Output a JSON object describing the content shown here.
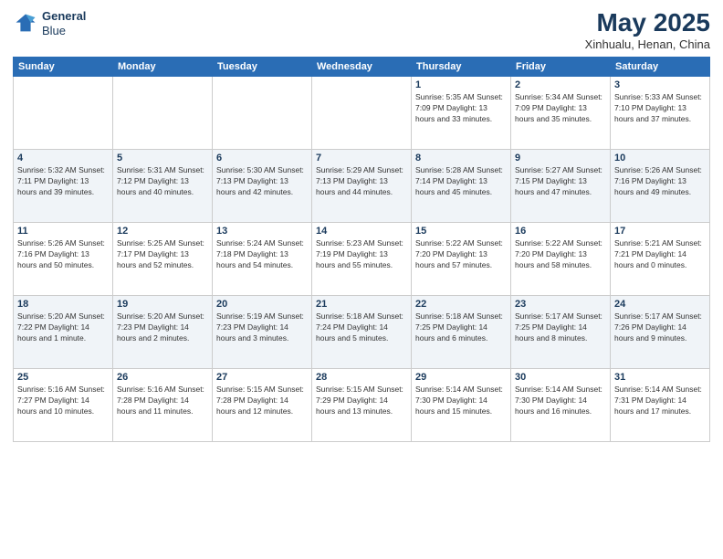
{
  "header": {
    "logo_line1": "General",
    "logo_line2": "Blue",
    "month": "May 2025",
    "location": "Xinhualu, Henan, China"
  },
  "weekdays": [
    "Sunday",
    "Monday",
    "Tuesday",
    "Wednesday",
    "Thursday",
    "Friday",
    "Saturday"
  ],
  "weeks": [
    [
      {
        "day": "",
        "info": ""
      },
      {
        "day": "",
        "info": ""
      },
      {
        "day": "",
        "info": ""
      },
      {
        "day": "",
        "info": ""
      },
      {
        "day": "1",
        "info": "Sunrise: 5:35 AM\nSunset: 7:09 PM\nDaylight: 13 hours\nand 33 minutes."
      },
      {
        "day": "2",
        "info": "Sunrise: 5:34 AM\nSunset: 7:09 PM\nDaylight: 13 hours\nand 35 minutes."
      },
      {
        "day": "3",
        "info": "Sunrise: 5:33 AM\nSunset: 7:10 PM\nDaylight: 13 hours\nand 37 minutes."
      }
    ],
    [
      {
        "day": "4",
        "info": "Sunrise: 5:32 AM\nSunset: 7:11 PM\nDaylight: 13 hours\nand 39 minutes."
      },
      {
        "day": "5",
        "info": "Sunrise: 5:31 AM\nSunset: 7:12 PM\nDaylight: 13 hours\nand 40 minutes."
      },
      {
        "day": "6",
        "info": "Sunrise: 5:30 AM\nSunset: 7:13 PM\nDaylight: 13 hours\nand 42 minutes."
      },
      {
        "day": "7",
        "info": "Sunrise: 5:29 AM\nSunset: 7:13 PM\nDaylight: 13 hours\nand 44 minutes."
      },
      {
        "day": "8",
        "info": "Sunrise: 5:28 AM\nSunset: 7:14 PM\nDaylight: 13 hours\nand 45 minutes."
      },
      {
        "day": "9",
        "info": "Sunrise: 5:27 AM\nSunset: 7:15 PM\nDaylight: 13 hours\nand 47 minutes."
      },
      {
        "day": "10",
        "info": "Sunrise: 5:26 AM\nSunset: 7:16 PM\nDaylight: 13 hours\nand 49 minutes."
      }
    ],
    [
      {
        "day": "11",
        "info": "Sunrise: 5:26 AM\nSunset: 7:16 PM\nDaylight: 13 hours\nand 50 minutes."
      },
      {
        "day": "12",
        "info": "Sunrise: 5:25 AM\nSunset: 7:17 PM\nDaylight: 13 hours\nand 52 minutes."
      },
      {
        "day": "13",
        "info": "Sunrise: 5:24 AM\nSunset: 7:18 PM\nDaylight: 13 hours\nand 54 minutes."
      },
      {
        "day": "14",
        "info": "Sunrise: 5:23 AM\nSunset: 7:19 PM\nDaylight: 13 hours\nand 55 minutes."
      },
      {
        "day": "15",
        "info": "Sunrise: 5:22 AM\nSunset: 7:20 PM\nDaylight: 13 hours\nand 57 minutes."
      },
      {
        "day": "16",
        "info": "Sunrise: 5:22 AM\nSunset: 7:20 PM\nDaylight: 13 hours\nand 58 minutes."
      },
      {
        "day": "17",
        "info": "Sunrise: 5:21 AM\nSunset: 7:21 PM\nDaylight: 14 hours\nand 0 minutes."
      }
    ],
    [
      {
        "day": "18",
        "info": "Sunrise: 5:20 AM\nSunset: 7:22 PM\nDaylight: 14 hours\nand 1 minute."
      },
      {
        "day": "19",
        "info": "Sunrise: 5:20 AM\nSunset: 7:23 PM\nDaylight: 14 hours\nand 2 minutes."
      },
      {
        "day": "20",
        "info": "Sunrise: 5:19 AM\nSunset: 7:23 PM\nDaylight: 14 hours\nand 3 minutes."
      },
      {
        "day": "21",
        "info": "Sunrise: 5:18 AM\nSunset: 7:24 PM\nDaylight: 14 hours\nand 5 minutes."
      },
      {
        "day": "22",
        "info": "Sunrise: 5:18 AM\nSunset: 7:25 PM\nDaylight: 14 hours\nand 6 minutes."
      },
      {
        "day": "23",
        "info": "Sunrise: 5:17 AM\nSunset: 7:25 PM\nDaylight: 14 hours\nand 8 minutes."
      },
      {
        "day": "24",
        "info": "Sunrise: 5:17 AM\nSunset: 7:26 PM\nDaylight: 14 hours\nand 9 minutes."
      }
    ],
    [
      {
        "day": "25",
        "info": "Sunrise: 5:16 AM\nSunset: 7:27 PM\nDaylight: 14 hours\nand 10 minutes."
      },
      {
        "day": "26",
        "info": "Sunrise: 5:16 AM\nSunset: 7:28 PM\nDaylight: 14 hours\nand 11 minutes."
      },
      {
        "day": "27",
        "info": "Sunrise: 5:15 AM\nSunset: 7:28 PM\nDaylight: 14 hours\nand 12 minutes."
      },
      {
        "day": "28",
        "info": "Sunrise: 5:15 AM\nSunset: 7:29 PM\nDaylight: 14 hours\nand 13 minutes."
      },
      {
        "day": "29",
        "info": "Sunrise: 5:14 AM\nSunset: 7:30 PM\nDaylight: 14 hours\nand 15 minutes."
      },
      {
        "day": "30",
        "info": "Sunrise: 5:14 AM\nSunset: 7:30 PM\nDaylight: 14 hours\nand 16 minutes."
      },
      {
        "day": "31",
        "info": "Sunrise: 5:14 AM\nSunset: 7:31 PM\nDaylight: 14 hours\nand 17 minutes."
      }
    ]
  ]
}
